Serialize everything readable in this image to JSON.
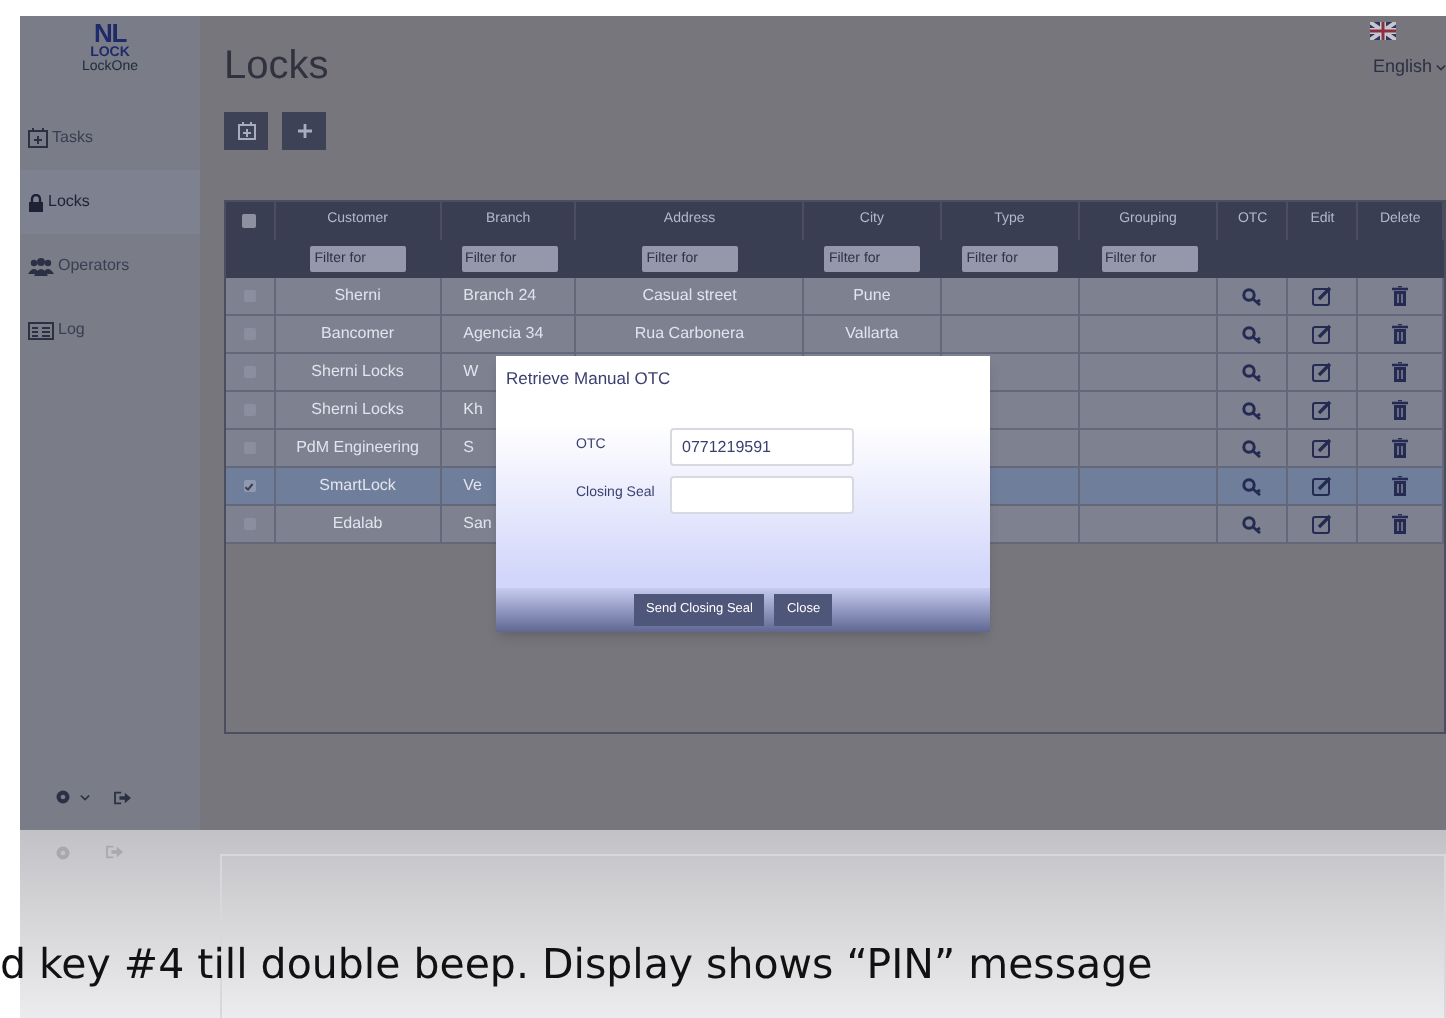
{
  "sidebar": {
    "logo": {
      "mark": "NL",
      "word": "LOCK",
      "name": "LockOne"
    },
    "items": [
      {
        "label": "Tasks",
        "selected": false
      },
      {
        "label": "Locks",
        "selected": true
      },
      {
        "label": "Operators",
        "selected": false
      },
      {
        "label": "Log",
        "selected": false
      }
    ]
  },
  "header": {
    "title": "Locks",
    "language": "English"
  },
  "table": {
    "select_all_checked": false,
    "columns": [
      "Customer",
      "Branch",
      "Address",
      "City",
      "Type",
      "Grouping",
      "OTC",
      "Edit",
      "Delete"
    ],
    "filters": [
      {
        "placeholder": "Filter for"
      },
      {
        "placeholder": "Filter for"
      },
      {
        "placeholder": "Filter for"
      },
      {
        "placeholder": "Filter for"
      },
      {
        "placeholder": "Filter for"
      },
      {
        "placeholder": "Filter for"
      }
    ],
    "rows": [
      {
        "checked": false,
        "selected": false,
        "customer": "Sherni",
        "branch": "Branch 24",
        "address": "Casual street",
        "city": "Pune"
      },
      {
        "checked": false,
        "selected": false,
        "customer": "Bancomer",
        "branch": "Agencia 34",
        "address": "Rua Carbonera",
        "city": "Vallarta"
      },
      {
        "checked": false,
        "selected": false,
        "customer": "Sherni Locks",
        "branch": "W"
      },
      {
        "checked": false,
        "selected": false,
        "customer": "Sherni Locks",
        "branch": "Kh"
      },
      {
        "checked": false,
        "selected": false,
        "customer": "PdM Engineering",
        "branch": "S"
      },
      {
        "checked": true,
        "selected": true,
        "customer": "SmartLock",
        "branch": "Ve"
      },
      {
        "checked": false,
        "selected": false,
        "customer": "Edalab",
        "branch": "San"
      }
    ]
  },
  "dialog": {
    "title": "Retrieve Manual OTC",
    "fields": [
      {
        "label": "OTC",
        "value": "0771219591"
      },
      {
        "label": "Closing Seal"
      }
    ],
    "buttons": [
      "Send Closing Seal",
      "Close"
    ]
  },
  "caption": "d key #4 till double beep. Display shows “PIN” message"
}
